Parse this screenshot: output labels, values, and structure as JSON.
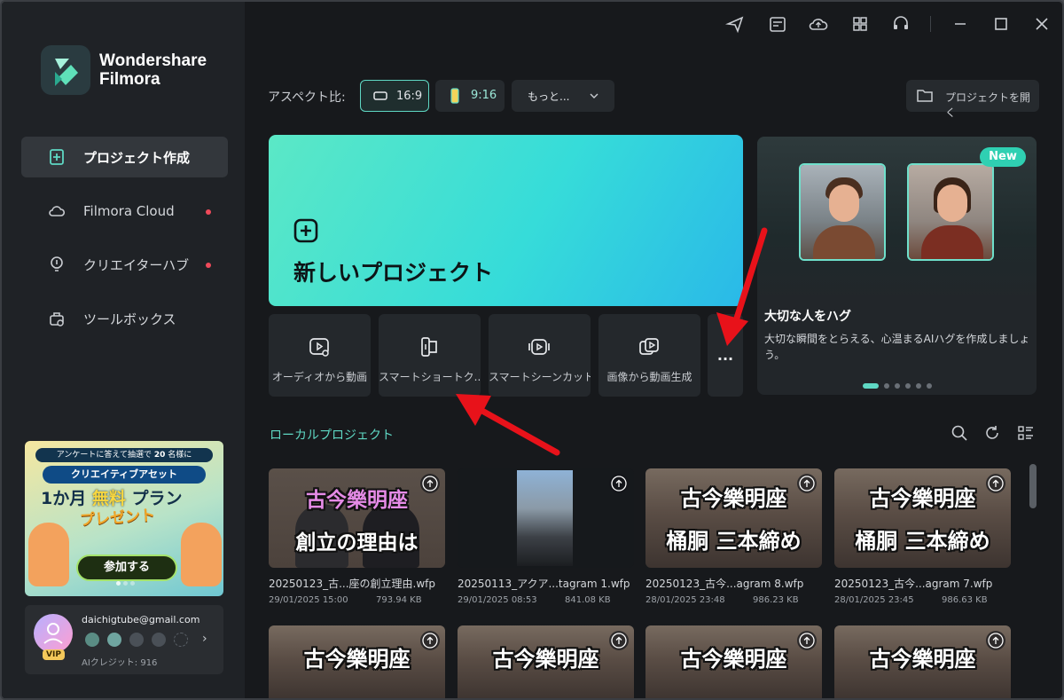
{
  "app": {
    "brand_line1": "Wondershare",
    "brand_line2": "Filmora"
  },
  "sidebar": {
    "items": [
      {
        "label": "プロジェクト作成",
        "icon": "new-project-icon",
        "active": true
      },
      {
        "label": "Filmora Cloud",
        "icon": "cloud-icon",
        "dot": true
      },
      {
        "label": "クリエイターハブ",
        "icon": "lightbulb-icon",
        "dot": true
      },
      {
        "label": "ツールボックス",
        "icon": "toolbox-icon"
      }
    ],
    "promo": {
      "line1": "アンケートに答えて抽選で",
      "count": "20",
      "line1_suffix": "名様に",
      "line2": "クリエイティブアセット",
      "line3a": "1か月",
      "line3b": "無料",
      "line3c": "プラン",
      "line4": "プレゼント",
      "button": "参加する"
    },
    "user": {
      "email": "daichigtube@gmail.com",
      "vip": "VIP",
      "credit": "AIクレジット: 916"
    }
  },
  "topbar": {
    "icons": [
      "send-icon",
      "calendar-icon",
      "cloud-upload-icon",
      "grid-icon",
      "headset-icon",
      "minimize-icon",
      "maximize-icon",
      "close-icon"
    ]
  },
  "aspect": {
    "label": "アスペクト比:",
    "options": [
      "16:9",
      "9:16",
      "もっと..."
    ],
    "selected": "16:9"
  },
  "open_project": "プロジェクトを開く",
  "new_project": "新しいプロジェクト",
  "feature": {
    "badge": "New",
    "title": "大切な人をハグ",
    "desc": "大切な瞬間をとらえる、心温まるAIハグを作成しましょう。"
  },
  "tools": [
    {
      "label": "オーディオから動画",
      "icon": "audio-to-video-icon"
    },
    {
      "label": "スマートショートク...",
      "icon": "smart-short-clip-icon"
    },
    {
      "label": "スマートシーンカット",
      "icon": "smart-scene-cut-icon"
    },
    {
      "label": "画像から動画生成",
      "icon": "image-to-video-icon"
    }
  ],
  "more": "...",
  "local": {
    "title": "ローカルプロジェクト",
    "projects": [
      {
        "file": "20250123_古...座の創立理由.wfp",
        "date": "29/01/2025 15:00",
        "size": "793.94 KB",
        "t1": "古今樂明座",
        "t2": "創立の理由は"
      },
      {
        "file": "20250113_アクア...tagram 1.wfp",
        "date": "29/01/2025 08:53",
        "size": "841.08 KB",
        "t1": "",
        "t2": ""
      },
      {
        "file": "20250123_古今...agram 8.wfp",
        "date": "28/01/2025 23:48",
        "size": "986.23 KB",
        "t1": "古今樂明座",
        "t2": "桶胴 三本締め"
      },
      {
        "file": "20250123_古今...agram 7.wfp",
        "date": "28/01/2025 23:45",
        "size": "986.63 KB",
        "t1": "古今樂明座",
        "t2": "桶胴 三本締め"
      },
      {
        "t1": "古今樂明座"
      },
      {
        "t1": "古今樂明座"
      },
      {
        "t1": "古今樂明座"
      },
      {
        "t1": "古今樂明座"
      }
    ]
  },
  "colors": {
    "accent": "#5fd8c4",
    "sidebar": "#1f2226",
    "bg": "#17191c",
    "arrow": "#e8121a"
  }
}
